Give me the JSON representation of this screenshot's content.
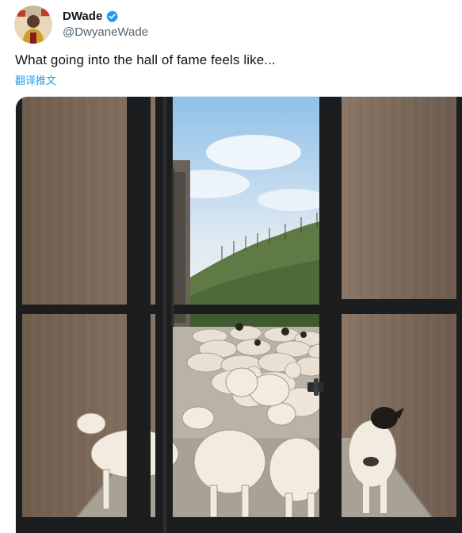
{
  "tweet": {
    "author": {
      "display_name": "DWade",
      "handle": "@DwyaneWade",
      "verified": true,
      "avatar": "avatar"
    },
    "text": "What going into the hall of fame feels like...",
    "translate_label": "翻译推文",
    "media": {
      "type": "photo",
      "icon": "photo-image"
    }
  },
  "colors": {
    "text": "#0f1419",
    "secondary": "#536471",
    "link": "#1d9bf0",
    "verified": "#1d9bf0"
  }
}
